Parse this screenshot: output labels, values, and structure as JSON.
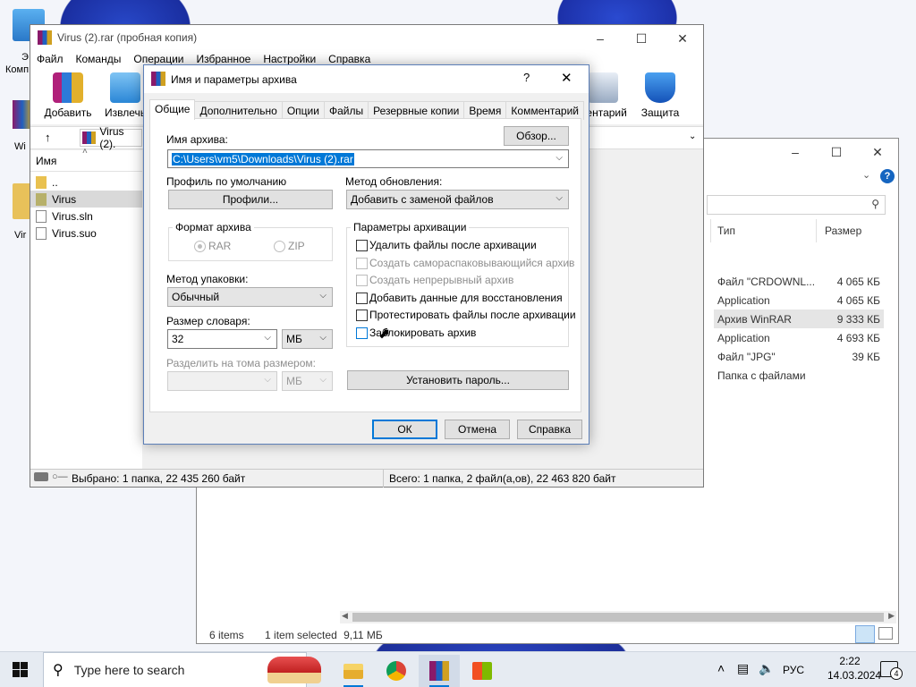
{
  "desktop": {
    "icons": [
      {
        "label": "Э",
        "sub": "Комп"
      },
      {
        "label": "Wi"
      },
      {
        "label": "Vir"
      }
    ]
  },
  "explorer": {
    "columns": {
      "type": "Тип",
      "size": "Размер"
    },
    "rows": [
      {
        "type": "Файл \"CRDOWNL...",
        "size": "4 065 КБ"
      },
      {
        "type": "Application",
        "size": "4 065 КБ"
      },
      {
        "type": "Архив WinRAR",
        "size": "9 333 КБ",
        "selected": true
      },
      {
        "type": "Application",
        "size": "4 693 КБ"
      },
      {
        "type": "Файл \"JPG\"",
        "size": "39 КБ"
      },
      {
        "type": "Папка с файлами",
        "size": ""
      }
    ],
    "status": {
      "items": "6 items",
      "selected": "1 item selected",
      "size": "9,11 МБ"
    }
  },
  "winrar": {
    "title": "Virus (2).rar (пробная копия)",
    "menu": [
      "Файл",
      "Команды",
      "Операции",
      "Избранное",
      "Настройки",
      "Справка"
    ],
    "toolbar": {
      "add": "Добавить",
      "extract": "Извлечь",
      "comment": "ментарий",
      "protect": "Защита"
    },
    "path": "Virus (2).",
    "list_header": "Имя",
    "items": [
      {
        "name": "..",
        "kind": "folder"
      },
      {
        "name": "Virus",
        "kind": "folder",
        "selected": true
      },
      {
        "name": "Virus.sln",
        "kind": "file"
      },
      {
        "name": "Virus.suo",
        "kind": "file"
      }
    ],
    "status_left": "Выбрано: 1 папка, 22 435 260 байт",
    "status_right": "Всего: 1 папка, 2 файл(а,ов), 22 463 820 байт"
  },
  "dialog": {
    "title": "Имя и параметры архива",
    "help_glyph": "?",
    "tabs": [
      "Общие",
      "Дополнительно",
      "Опции",
      "Файлы",
      "Резервные копии",
      "Время",
      "Комментарий"
    ],
    "active_tab": "Общие",
    "archive_name_label": "Имя архива:",
    "browse_button": "Обзор...",
    "archive_name_value": "C:\\Users\\vm5\\Downloads\\Virus (2).rar",
    "default_profile_label": "Профиль по умолчанию",
    "profiles_button": "Профили...",
    "update_method_label": "Метод обновления:",
    "update_method_value": "Добавить с заменой файлов",
    "format_group": "Формат архива",
    "format_rar": "RAR",
    "format_zip": "ZIP",
    "compression_label": "Метод упаковки:",
    "compression_value": "Обычный",
    "dictionary_label": "Размер словаря:",
    "dictionary_value": "32",
    "dictionary_unit": "МБ",
    "split_label": "Разделить на тома размером:",
    "split_value": "",
    "split_unit": "МБ",
    "options_group": "Параметры архивации",
    "options": [
      {
        "label": "Удалить файлы после архивации",
        "checked": false,
        "enabled": true
      },
      {
        "label": "Создать самораспаковывающийся архив",
        "checked": false,
        "enabled": false
      },
      {
        "label": "Создать непрерывный архив",
        "checked": false,
        "enabled": false
      },
      {
        "label": "Добавить данные для восстановления",
        "checked": false,
        "enabled": true
      },
      {
        "label": "Протестировать файлы после архивации",
        "checked": false,
        "enabled": true
      },
      {
        "label": "Заблокировать архив",
        "checked": false,
        "enabled": true
      }
    ],
    "password_button": "Установить пароль...",
    "ok_button": "ОК",
    "cancel_button": "Отмена",
    "help_button": "Справка"
  },
  "taskbar": {
    "search_placeholder": "Type here to search",
    "language": "РУС",
    "time": "2:22",
    "date": "14.03.2024",
    "notifications": "4"
  }
}
